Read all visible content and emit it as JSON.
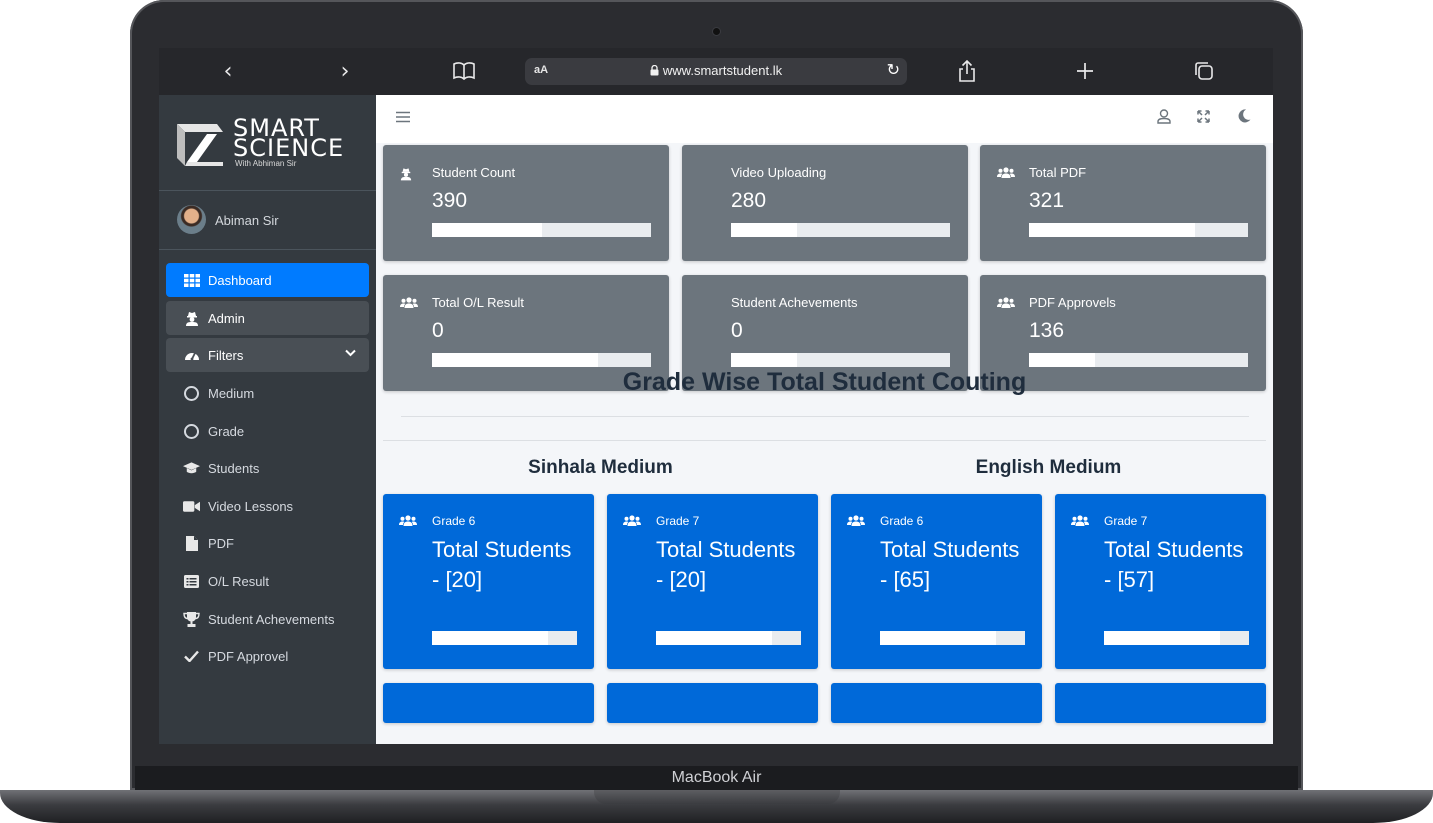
{
  "device": {
    "brand": "MacBook Air"
  },
  "browser": {
    "back_icon": "‹",
    "forward_icon": "›",
    "reader_label": "aA",
    "url": "www.smartstudent.lk"
  },
  "sidebar": {
    "logo": {
      "line1": "SMART",
      "line2": "SCIENCE",
      "tagline": "With Abhiman Sir"
    },
    "user_name": "Abiman Sir",
    "items": [
      {
        "label": "Dashboard",
        "icon": "grid-icon"
      },
      {
        "label": "Admin",
        "icon": "user-secret-icon"
      },
      {
        "label": "Filters",
        "icon": "tachometer-icon"
      },
      {
        "label": "Medium",
        "icon": "circle-icon"
      },
      {
        "label": "Grade",
        "icon": "circle-icon"
      },
      {
        "label": "Students",
        "icon": "graduation-cap-icon"
      },
      {
        "label": "Video Lessons",
        "icon": "video-icon"
      },
      {
        "label": "PDF",
        "icon": "file-icon"
      },
      {
        "label": "O/L Result",
        "icon": "list-icon"
      },
      {
        "label": "Student Achevements",
        "icon": "trophy-icon"
      },
      {
        "label": "PDF Approvel",
        "icon": "check-icon"
      }
    ]
  },
  "stats": [
    {
      "label": "Student Count",
      "value": "390",
      "icon": "user-secret-icon",
      "progress": 0.5
    },
    {
      "label": "Video Uploading",
      "value": "280",
      "icon": "",
      "progress": 0.3
    },
    {
      "label": "Total PDF",
      "value": "321",
      "icon": "users-icon",
      "progress": 0.76
    },
    {
      "label": "Total O/L Result",
      "value": "0",
      "icon": "users-icon",
      "progress": 0.76
    },
    {
      "label": "Student Achevements",
      "value": "0",
      "icon": "",
      "progress": 0.3
    },
    {
      "label": "PDF Approvels",
      "value": "136",
      "icon": "users-icon",
      "progress": 0.3
    }
  ],
  "main": {
    "heading": "Grade Wise Total Student Couting",
    "sinhala_title": "Sinhala Medium",
    "english_title": "English Medium"
  },
  "grades": [
    {
      "label": "Grade 6",
      "value": "Total Students - [20]",
      "progress": 0.8
    },
    {
      "label": "Grade 7",
      "value": "Total Students - [20]",
      "progress": 0.8
    },
    {
      "label": "Grade 6",
      "value": "Total Students - [65]",
      "progress": 0.8
    },
    {
      "label": "Grade 7",
      "value": "Total Students - [57]",
      "progress": 0.8
    }
  ],
  "colors": {
    "primary": "#007bff",
    "card_gray": "#6c757d",
    "grade_blue": "#0069d9",
    "sidebar": "#343a40"
  }
}
